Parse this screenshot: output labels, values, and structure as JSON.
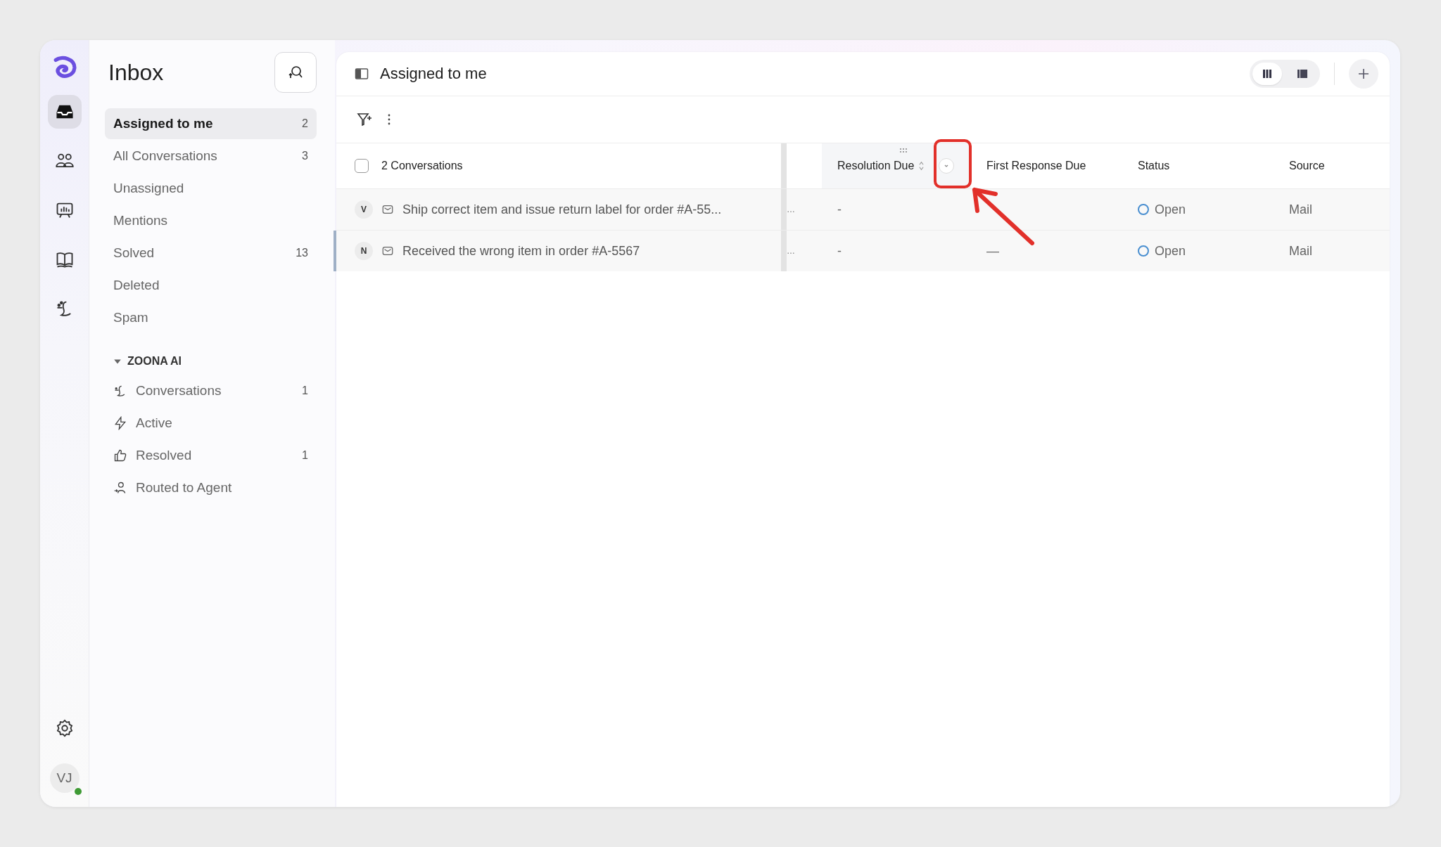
{
  "rail": {
    "items": [
      {
        "selected": true
      },
      {
        "selected": false
      },
      {
        "selected": false
      },
      {
        "selected": false
      },
      {
        "selected": false
      }
    ],
    "avatar": {
      "initials": "VJ",
      "online": true
    }
  },
  "sidebar": {
    "title": "Inbox",
    "items": [
      {
        "label": "Assigned to me",
        "count": "2",
        "selected": true
      },
      {
        "label": "All Conversations",
        "count": "3",
        "selected": false
      },
      {
        "label": "Unassigned",
        "selected": false
      },
      {
        "label": "Mentions",
        "selected": false
      },
      {
        "label": "Solved",
        "count": "13",
        "selected": false
      },
      {
        "label": "Deleted",
        "selected": false
      },
      {
        "label": "Spam",
        "selected": false
      }
    ],
    "section": {
      "title": "ZOONA AI",
      "expanded": true,
      "items": [
        {
          "label": "Conversations",
          "count": "1",
          "selected": false
        },
        {
          "label": "Active",
          "selected": false
        },
        {
          "label": "Resolved",
          "count": "1",
          "selected": false
        },
        {
          "label": "Routed to Agent",
          "selected": false
        }
      ]
    }
  },
  "main": {
    "title": "Assigned to me",
    "views": [
      {
        "selected": true
      },
      {
        "selected": false
      }
    ],
    "table": {
      "select_all": {
        "checked": false
      },
      "count_label": "2 Conversations",
      "columns": [
        {
          "label": "Resolution Due"
        },
        {
          "label": "First Response Due"
        },
        {
          "label": "Status"
        },
        {
          "label": "Source"
        }
      ],
      "rows": [
        {
          "initial": "V",
          "title": "Ship correct item and issue return label for order #A-55...",
          "column_2": "…",
          "resolution_due": "-",
          "status": "Open",
          "source": "Mail",
          "selected": false
        },
        {
          "initial": "N",
          "title": "Received the wrong item in order #A-5567",
          "column_2": "…",
          "resolution_due": "-",
          "first_response_due": "—",
          "status": "Open",
          "source": "Mail",
          "selected": true
        }
      ]
    }
  }
}
